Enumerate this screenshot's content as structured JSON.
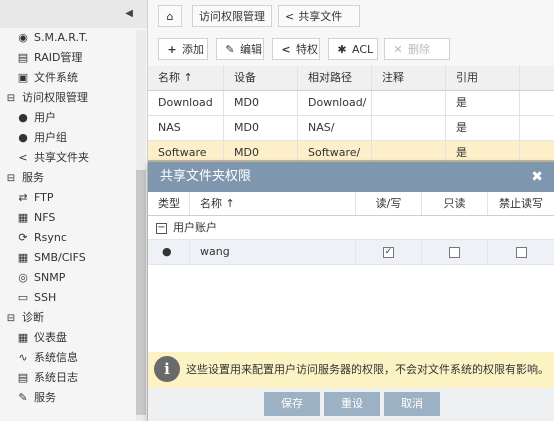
{
  "sidebar": {
    "collapse_icon": "chevron-left-icon",
    "items": [
      {
        "label": "S.M.A.R.T.",
        "icon": "smart-icon"
      },
      {
        "label": "RAID管理",
        "icon": "raid-icon"
      },
      {
        "label": "文件系统",
        "icon": "filesystem-icon"
      },
      {
        "label": "访问权限管理",
        "icon": "access-icon"
      },
      {
        "label": "用户",
        "icon": "user-icon"
      },
      {
        "label": "用户组",
        "icon": "group-icon"
      },
      {
        "label": "共享文件夹",
        "icon": "share-icon"
      },
      {
        "label": "服务",
        "icon": "service-icon"
      },
      {
        "label": "FTP",
        "icon": "ftp-icon"
      },
      {
        "label": "NFS",
        "icon": "nfs-icon"
      },
      {
        "label": "Rsync",
        "icon": "rsync-icon"
      },
      {
        "label": "SMB/CIFS",
        "icon": "smb-icon"
      },
      {
        "label": "SNMP",
        "icon": "snmp-icon"
      },
      {
        "label": "SSH",
        "icon": "ssh-icon"
      },
      {
        "label": "诊断",
        "icon": "diagnostics-icon"
      },
      {
        "label": "仪表盘",
        "icon": "dashboard-icon"
      },
      {
        "label": "系统信息",
        "icon": "sysinfo-icon"
      },
      {
        "label": "系统日志",
        "icon": "syslog-icon"
      },
      {
        "label": "服务",
        "icon": "wrench-icon"
      }
    ]
  },
  "breadcrumb": {
    "home_icon": "home-icon",
    "tab1": "访问权限管理",
    "tab2": "共享文件夹"
  },
  "toolbar": {
    "add": "添加",
    "edit": "编辑",
    "privileges": "特权",
    "acl": "ACL",
    "delete": "删除"
  },
  "table": {
    "headers": {
      "name": "名称",
      "device": "设备",
      "path": "相对路径",
      "comment": "注释",
      "referenced": "引用"
    },
    "sort_arrow": "↑",
    "rows": [
      {
        "name": "Download",
        "device": "MD0",
        "path": "Download/",
        "comment": "",
        "referenced": "是"
      },
      {
        "name": "NAS",
        "device": "MD0",
        "path": "NAS/",
        "comment": "",
        "referenced": "是"
      },
      {
        "name": "Software",
        "device": "MD0",
        "path": "Software/",
        "comment": "",
        "referenced": "是"
      }
    ]
  },
  "dialog": {
    "title": "共享文件夹权限",
    "close_icon": "close-icon",
    "headers": {
      "type": "类型",
      "name": "名称",
      "read_write": "读/写",
      "read_only": "只读",
      "no_access": "禁止读写"
    },
    "group_label": "用户账户",
    "user": {
      "name": "wang",
      "read_write": true,
      "read_only": false,
      "no_access": false
    },
    "info_text": "这些设置用来配置用户访问服务器的权限，不会对文件系统的权限有影响。",
    "buttons": {
      "save": "保存",
      "reset": "重设",
      "cancel": "取消"
    }
  },
  "colors": {
    "dialog_header": "#7f97ae",
    "selected_row": "#fcefc9",
    "info_bg": "#fcf3c4",
    "button": "#9db1c5"
  }
}
